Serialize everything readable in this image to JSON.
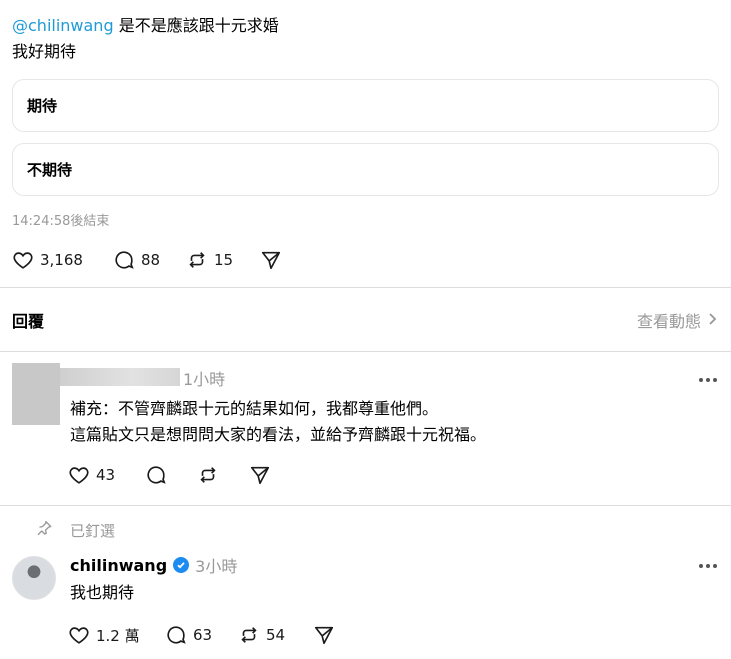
{
  "post": {
    "mention": "@chilinwang",
    "question": " 是不是應該跟十元求婚",
    "subtitle": "我好期待",
    "poll_options": [
      "期待",
      "不期待"
    ],
    "poll_end": "14:24:58後結束",
    "likes": "3,168",
    "comments": "88",
    "reposts": "15"
  },
  "replies": {
    "header": "回覆",
    "view_activity": "查看動態"
  },
  "reply1": {
    "time": "1小時",
    "line1": "補充：不管齊麟跟十元的結果如何，我都尊重他們。",
    "line2": "這篇貼文只是想問問大家的看法，並給予齊麟跟十元祝福。",
    "likes": "43"
  },
  "reply2": {
    "pinned_label": "已釘選",
    "username": "chilinwang",
    "time": "3小時",
    "text": "我也期待",
    "likes": "1.2 萬",
    "comments": "63",
    "reposts": "54"
  },
  "colors": {
    "mention": "#1e9bd7",
    "verified": "#1d8cf0",
    "muted": "#999999"
  }
}
